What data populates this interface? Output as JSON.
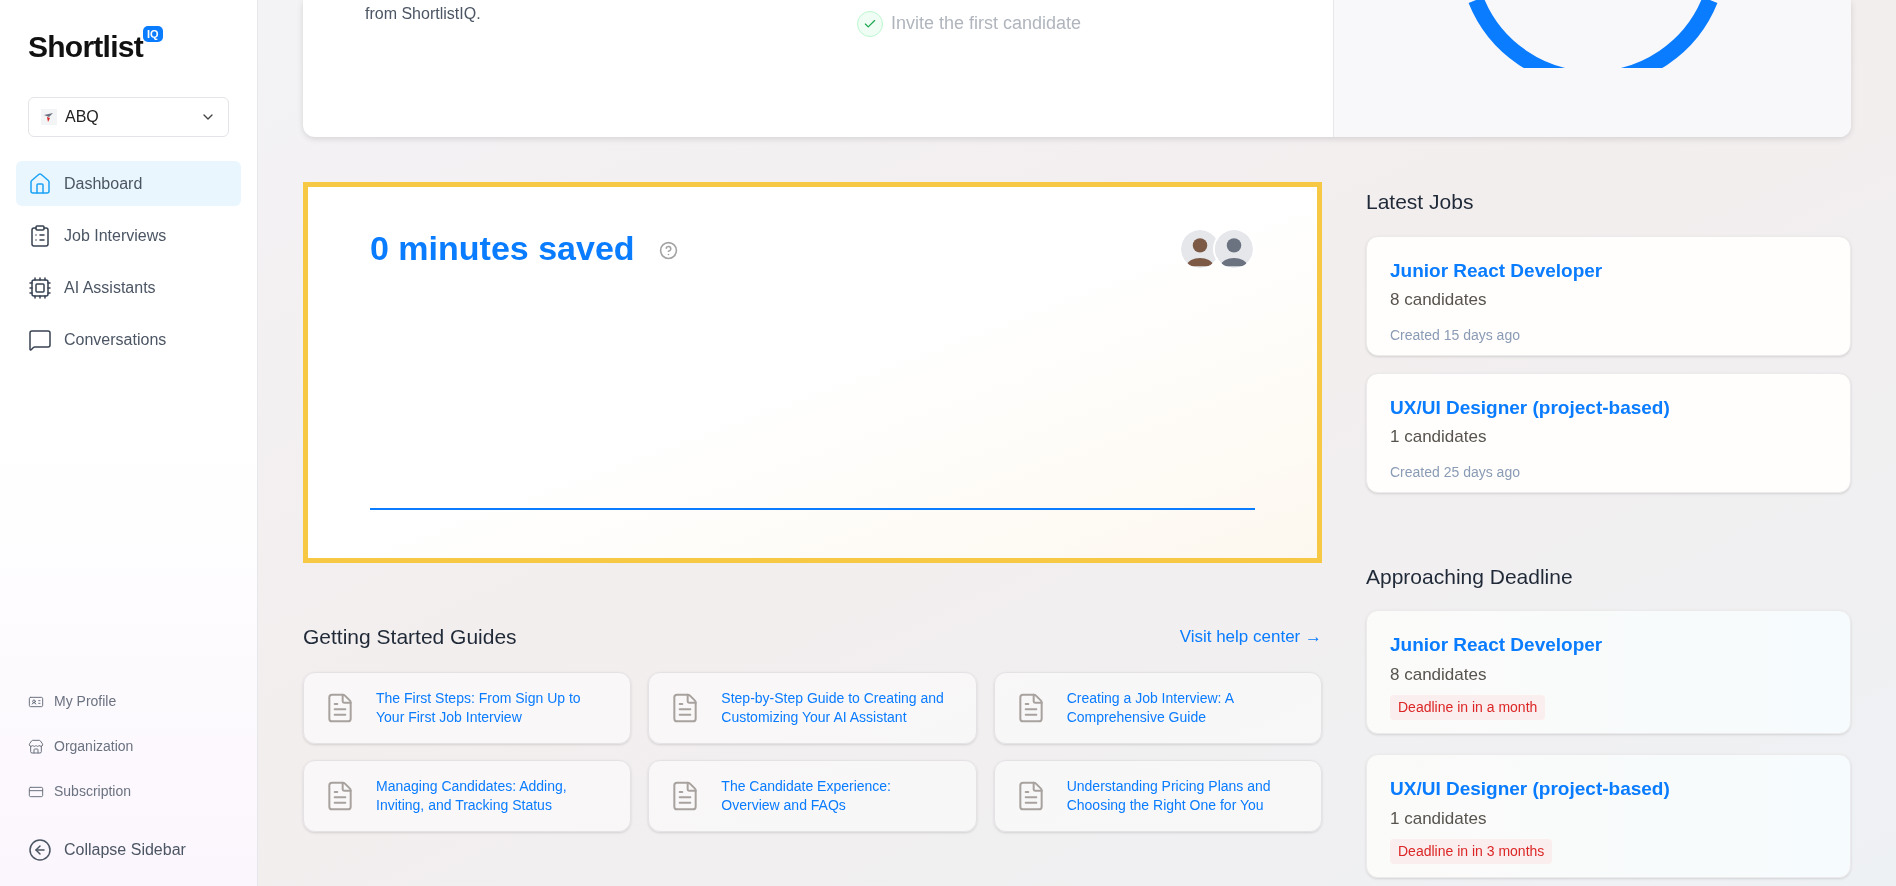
{
  "sidebar": {
    "logo": "Shortlist",
    "logo_badge": "IQ",
    "org_select": {
      "value": "ABQ"
    },
    "nav": [
      {
        "label": "Dashboard",
        "selected": true
      },
      {
        "label": "Job Interviews",
        "selected": false
      },
      {
        "label": "AI Assistants",
        "selected": false
      },
      {
        "label": "Conversations",
        "selected": false
      }
    ],
    "footer_links": [
      {
        "label": "My Profile"
      },
      {
        "label": "Organization"
      },
      {
        "label": "Subscription"
      }
    ],
    "collapse": "Collapse Sidebar"
  },
  "onboarding": {
    "intro_text": "from ShortlistIQ.",
    "steps": [
      {
        "label": "Invite the first candidate",
        "checked": true
      }
    ]
  },
  "minutes_card": {
    "title": "0 minutes saved"
  },
  "guides": {
    "title": "Getting Started Guides",
    "link": "Visit help center →",
    "items": [
      {
        "title": "The First Steps: From Sign Up to Your First Job Interview"
      },
      {
        "title": "Step-by-Step Guide to Creating and Customizing Your AI Assistant"
      },
      {
        "title": "Creating a Job Interview: A Comprehensive Guide"
      },
      {
        "title": "Managing Candidates: Adding, Inviting, and Tracking Status"
      },
      {
        "title": "The Candidate Experience: Overview and FAQs"
      },
      {
        "title": "Understanding Pricing Plans and Choosing the Right One for You"
      }
    ]
  },
  "latest_jobs": {
    "title": "Latest Jobs",
    "items": [
      {
        "title": "Junior React Developer",
        "candidates": "8 candidates",
        "created": "Created 15 days ago"
      },
      {
        "title": "UX/UI Designer (project-based)",
        "candidates": "1 candidates",
        "created": "Created 25 days ago"
      }
    ]
  },
  "approaching_deadline": {
    "title": "Approaching Deadline",
    "items": [
      {
        "title": "Junior React Developer",
        "candidates": "8 candidates",
        "deadline": "Deadline in in a month"
      },
      {
        "title": "UX/UI Designer (project-based)",
        "candidates": "1 candidates",
        "deadline": "Deadline in in 3 months"
      }
    ]
  }
}
